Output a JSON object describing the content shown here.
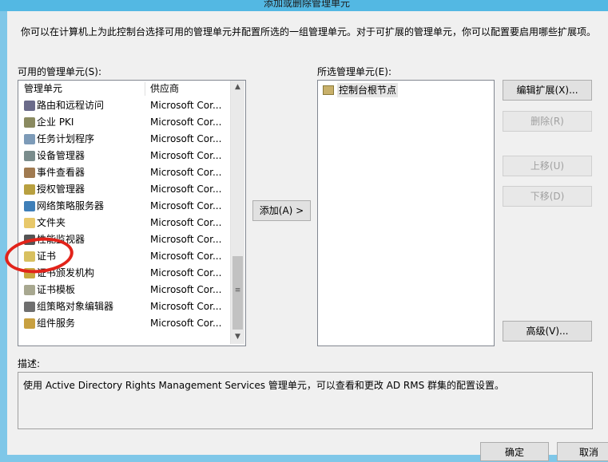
{
  "window": {
    "title": "添加或删除管理单元"
  },
  "intro_text": "你可以在计算机上为此控制台选择可用的管理单元并配置所选的一组管理单元。对于可扩展的管理单元，你可以配置要启用哪些扩展项。",
  "available": {
    "label": "可用的管理单元(S):",
    "columns": [
      "管理单元",
      "供应商"
    ],
    "rows": [
      {
        "name": "路由和远程访问",
        "vendor": "Microsoft Cor...",
        "icon": "routing-icon",
        "color": "#6b6b8a"
      },
      {
        "name": "企业 PKI",
        "vendor": "Microsoft Cor...",
        "icon": "enterprise-pki-icon",
        "color": "#8a8a60"
      },
      {
        "name": "任务计划程序",
        "vendor": "Microsoft Cor...",
        "icon": "task-scheduler-icon",
        "color": "#7d9bb8"
      },
      {
        "name": "设备管理器",
        "vendor": "Microsoft Cor...",
        "icon": "device-manager-icon",
        "color": "#7a8c8c"
      },
      {
        "name": "事件查看器",
        "vendor": "Microsoft Cor...",
        "icon": "event-viewer-icon",
        "color": "#a07a50"
      },
      {
        "name": "授权管理器",
        "vendor": "Microsoft Cor...",
        "icon": "authorization-manager-icon",
        "color": "#b8a040"
      },
      {
        "name": "网络策略服务器",
        "vendor": "Microsoft Cor...",
        "icon": "network-policy-server-icon",
        "color": "#3f7fb8"
      },
      {
        "name": "文件夹",
        "vendor": "Microsoft Cor...",
        "icon": "folder-icon",
        "color": "#e8c86a"
      },
      {
        "name": "性能监视器",
        "vendor": "Microsoft Cor...",
        "icon": "performance-monitor-icon",
        "color": "#555555"
      },
      {
        "name": "证书",
        "vendor": "Microsoft Cor...",
        "icon": "certificate-icon",
        "color": "#d8c060"
      },
      {
        "name": "证书颁发机构",
        "vendor": "Microsoft Cor...",
        "icon": "certificate-authority-icon",
        "color": "#c8a840"
      },
      {
        "name": "证书模板",
        "vendor": "Microsoft Cor...",
        "icon": "certificate-template-icon",
        "color": "#a8a890"
      },
      {
        "name": "组策略对象编辑器",
        "vendor": "Microsoft Cor...",
        "icon": "group-policy-icon",
        "color": "#6f6f6f"
      },
      {
        "name": "组件服务",
        "vendor": "Microsoft Cor...",
        "icon": "component-services-icon",
        "color": "#c8a040"
      }
    ]
  },
  "add_button": "添加(A) >",
  "selected": {
    "label": "所选管理单元(E):",
    "items": [
      {
        "name": "控制台根节点",
        "icon": "console-root-folder-icon"
      }
    ]
  },
  "buttons": {
    "edit_extensions": "编辑扩展(X)...",
    "remove": "删除(R)",
    "move_up": "上移(U)",
    "move_down": "下移(D)",
    "advanced": "高级(V)...",
    "ok": "确定",
    "cancel": "取消"
  },
  "description": {
    "label": "描述:",
    "text": "使用 Active Directory Rights Management Services 管理单元，可以查看和更改 AD RMS 群集的配置设置。"
  },
  "colors": {
    "titlebar": "#53b8e3",
    "annotation": "#e2231a"
  }
}
